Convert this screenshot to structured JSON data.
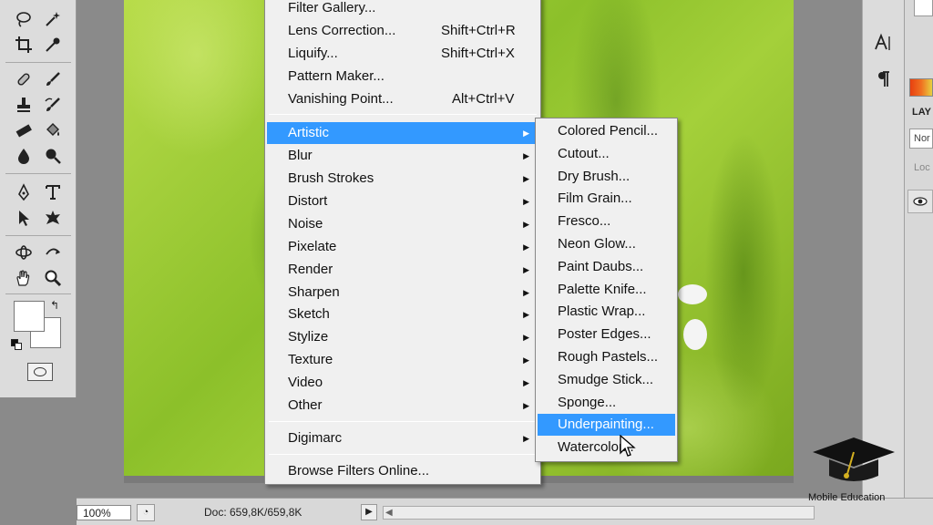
{
  "filter_menu": {
    "top_items": [
      {
        "label": "Filter Gallery...",
        "shortcut": ""
      },
      {
        "label": "Lens Correction...",
        "shortcut": "Shift+Ctrl+R"
      },
      {
        "label": "Liquify...",
        "shortcut": "Shift+Ctrl+X"
      },
      {
        "label": "Pattern Maker...",
        "shortcut": ""
      },
      {
        "label": "Vanishing Point...",
        "shortcut": "Alt+Ctrl+V"
      }
    ],
    "categories": [
      {
        "label": "Artistic",
        "highlighted": true
      },
      {
        "label": "Blur"
      },
      {
        "label": "Brush Strokes"
      },
      {
        "label": "Distort"
      },
      {
        "label": "Noise"
      },
      {
        "label": "Pixelate"
      },
      {
        "label": "Render"
      },
      {
        "label": "Sharpen"
      },
      {
        "label": "Sketch"
      },
      {
        "label": "Stylize"
      },
      {
        "label": "Texture"
      },
      {
        "label": "Video"
      },
      {
        "label": "Other"
      }
    ],
    "digimarc": "Digimarc",
    "browse_online": "Browse Filters Online..."
  },
  "artistic_submenu": {
    "items": [
      "Colored Pencil...",
      "Cutout...",
      "Dry Brush...",
      "Film Grain...",
      "Fresco...",
      "Neon Glow...",
      "Paint Daubs...",
      "Palette Knife...",
      "Plastic Wrap...",
      "Poster Edges...",
      "Rough Pastels...",
      "Smudge Stick...",
      "Sponge...",
      "Underpainting...",
      "Watercolor..."
    ],
    "highlighted_index": 13
  },
  "status_bar": {
    "zoom": "100%",
    "doc_info": "Doc: 659,8K/659,8K"
  },
  "right_panel": {
    "layers_tab": "LAY",
    "blend_mode": "Nor",
    "lock_label": "Loc"
  },
  "watermark": {
    "text": "Mobile Education"
  },
  "colors": {
    "menu_highlight": "#3399ff",
    "menu_bg": "#f0f0f0",
    "panel_bg": "#dcdcdc",
    "workspace_bg": "#8a8a8a"
  }
}
